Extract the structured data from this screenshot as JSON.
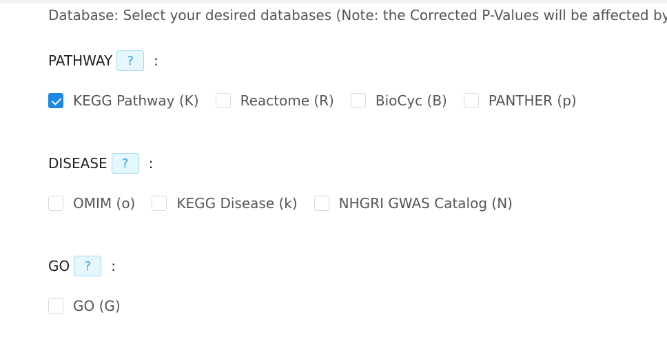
{
  "intro_text": "Database: Select your desired databases (Note: the Corrected P-Values will be affected by",
  "sections": [
    {
      "title": "PATHWAY",
      "help_label": "?",
      "colon": ":",
      "options": [
        {
          "label": "KEGG Pathway (K)",
          "checked": true
        },
        {
          "label": "Reactome (R)",
          "checked": false
        },
        {
          "label": "BioCyc (B)",
          "checked": false
        },
        {
          "label": "PANTHER (p)",
          "checked": false
        }
      ]
    },
    {
      "title": "DISEASE",
      "help_label": "?",
      "colon": ":",
      "options": [
        {
          "label": "OMIM (o)",
          "checked": false
        },
        {
          "label": "KEGG Disease (k)",
          "checked": false
        },
        {
          "label": "NHGRI GWAS Catalog (N)",
          "checked": false
        }
      ]
    },
    {
      "title": "GO",
      "help_label": "?",
      "colon": ":",
      "options": [
        {
          "label": "GO (G)",
          "checked": false
        }
      ]
    }
  ],
  "colors": {
    "accent": "#1e88e5",
    "help_bg": "#e6f6fd",
    "help_border": "#9fd8f4",
    "help_text": "#2aa3e6"
  }
}
